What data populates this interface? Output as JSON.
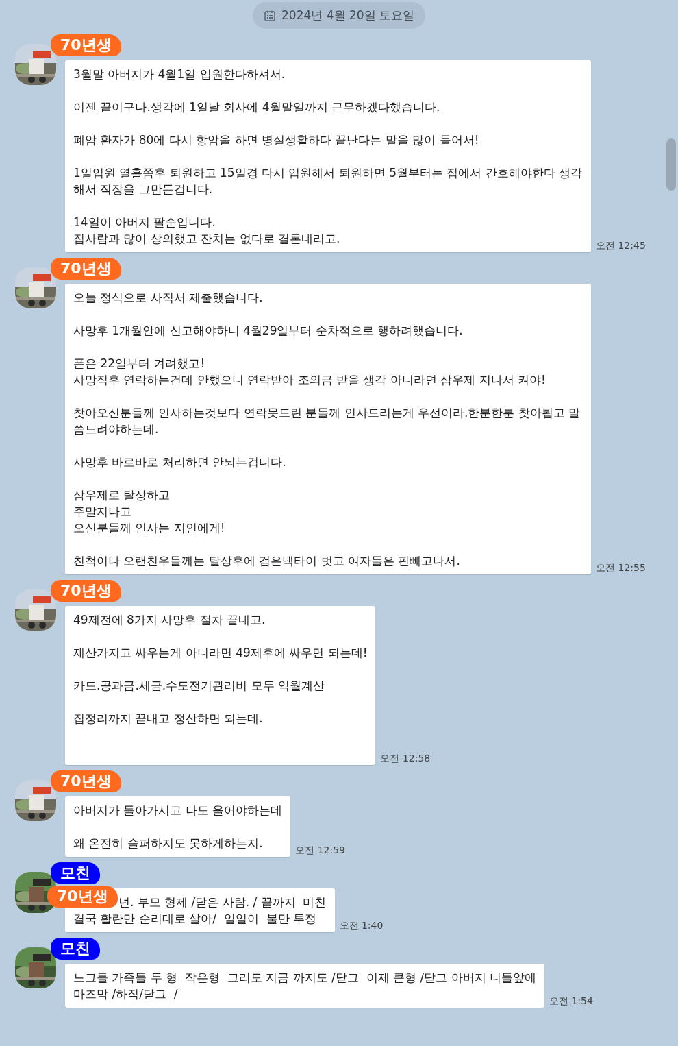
{
  "date_divider": {
    "label": "2024년 4월 20일 토요일"
  },
  "messages": [
    {
      "sender": {
        "name": "70년생",
        "color": "#ff6a1f"
      },
      "time": "오전 12:45",
      "paragraphs": [
        [
          "3월말 아버지가 4월1일 입원한다하셔서."
        ],
        [
          "이젠 끝이구나.생각에 1일날 회사에 4월말일까지 근무하겠다했습니다."
        ],
        [
          "폐암 환자가 80에 다시 항암을 하면 병실생활하다 끝난다는 말을 많이 들어서!"
        ],
        [
          "1일입원 열흘쯤후 퇴원하고 15일경 다시 입원해서 퇴원하면 5월부터는 집에서 간호해야한다 생각해서 직장을 그만둔겁니다."
        ],
        [
          "14일이 아버지 팔순입니다.",
          "집사람과 많이 상의했고 잔치는 없다로 결론내리고."
        ]
      ]
    },
    {
      "sender": {
        "name": "70년생",
        "color": "#ff6a1f"
      },
      "time": "오전 12:55",
      "paragraphs": [
        [
          "오늘 정식으로 사직서 제출했습니다."
        ],
        [
          "사망후 1개월안에 신고해야하니 4월29일부터 순차적으로 행하려했습니다."
        ],
        [
          "폰은 22일부터 켜려했고!",
          "사망직후 연락하는건데 안했으니 연락받아 조의금 받을 생각 아니라면 삼우제 지나서 켜야!"
        ],
        [
          "찾아오신분들께 인사하는것보다 연락못드린 분들께 인사드리는게 우선이라.한분한분 찾아뵙고 말씀드려야하는데."
        ],
        [
          "사망후 바로바로 처리하면 안되는겁니다."
        ],
        [
          "삼우제로 탈상하고",
          "주말지나고",
          "오신분들께 인사는 지인에게!"
        ],
        [
          "친척이나 오랜친우들께는 탈상후에 검은넥타이 벗고 여자들은 핀빼고나서."
        ]
      ]
    },
    {
      "sender": {
        "name": "70년생",
        "color": "#ff6a1f"
      },
      "time": "오전 12:58",
      "paragraphs": [
        [
          "49제전에 8가지 사망후 절차 끝내고."
        ],
        [
          "재산가지고 싸우는게 아니라면 49제후에 싸우면 되는데!"
        ],
        [
          "카드.공과금.세금.수도전기관리비 모두 익월계산"
        ],
        [
          "집정리까지 끝내고 정산하면 되는데."
        ]
      ]
    },
    {
      "sender": {
        "name": "70년생",
        "color": "#ff6a1f"
      },
      "time": "오전 12:59",
      "paragraphs": [
        [
          "아버지가 돌아가시고 나도 울어야하는데"
        ],
        [
          "왜 온전히 슬퍼하지도 못하게하는지."
        ]
      ]
    },
    {
      "sender": {
        "name": "모친",
        "color": "#0000ff"
      },
      "time": "오전 1:40",
      "overlay_tag": {
        "name": "70년생",
        "color": "#ff6a1f"
      },
      "paragraphs": [
        [
          "넌. 부모 형제 /닫은 사람. / 끝까지  미친",
          "결국 활란만 순리대로 살아/  일일이  불만 투정"
        ]
      ]
    },
    {
      "sender": {
        "name": "모친",
        "color": "#0000ff"
      },
      "time": "오전 1:54",
      "paragraphs": [
        [
          "느그들 가족들 두 형  작은형  그리도 지금 까지도 /닫그  이제 큰형 /닫그 아버지 니들앞에",
          "마즈막 /하직/닫그  /"
        ]
      ]
    }
  ]
}
